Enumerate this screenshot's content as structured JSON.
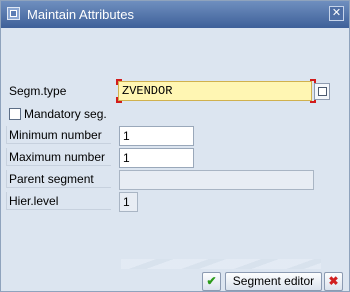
{
  "dialog": {
    "title": "Maintain Attributes",
    "close_glyph": "✕"
  },
  "fields": {
    "segm_type": {
      "label": "Segm.type",
      "value": "ZVENDOR"
    },
    "mandatory": {
      "label": "Mandatory seg.",
      "checked": false
    },
    "min_number": {
      "label": "Minimum number",
      "value": "1"
    },
    "max_number": {
      "label": "Maximum number",
      "value": "1"
    },
    "parent_segment": {
      "label": "Parent segment",
      "value": ""
    },
    "hier_level": {
      "label": "Hier.level",
      "value": "1"
    }
  },
  "buttons": {
    "ok_glyph": "✔",
    "segment_editor_label": "Segment editor",
    "cancel_glyph": "✖"
  },
  "icons": {
    "window": "window-icon",
    "value_help": "value-help-icon"
  },
  "colors": {
    "titlebar": "#4a6ca5",
    "required_highlight": "#fff6b3",
    "focus_corner": "#d21c1c",
    "ok": "#2b9b1a",
    "cancel": "#d11f1f"
  }
}
